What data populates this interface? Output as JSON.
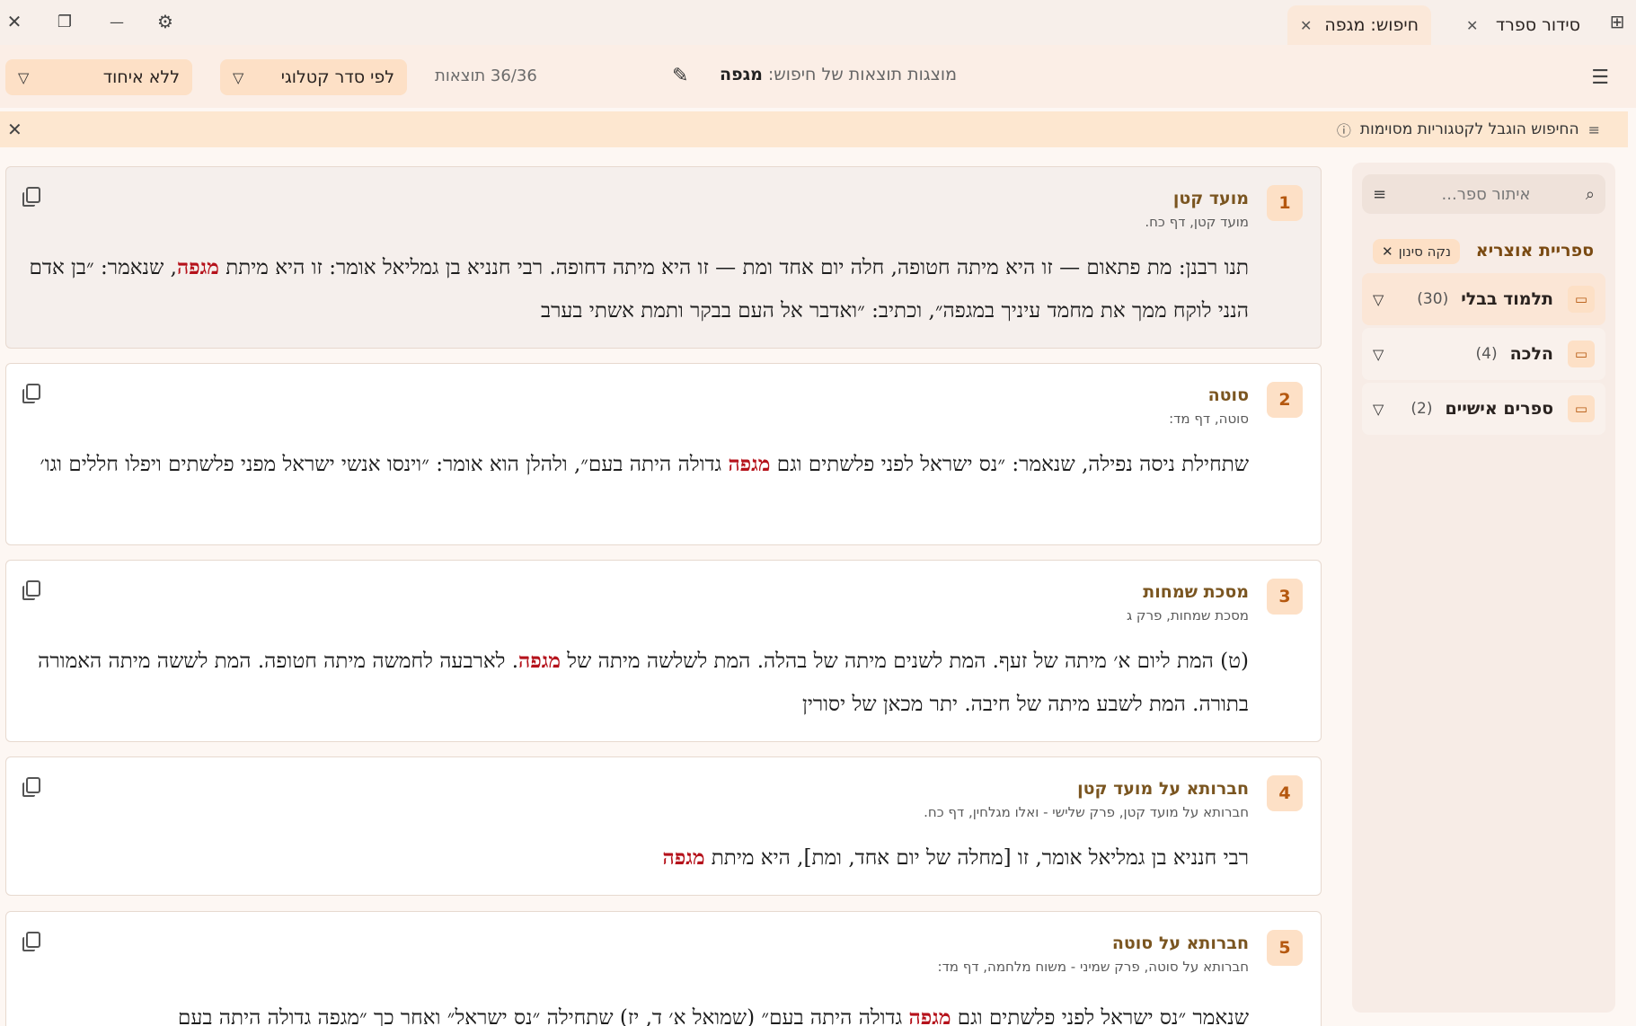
{
  "window": {
    "close_glyph": "✕",
    "restore_glyph": "❐",
    "minimize_glyph": "—",
    "settings_glyph": "⚙",
    "new_tab_glyph": "⊞"
  },
  "tabs": [
    {
      "label": "חיפוש: מגפה",
      "active": true
    },
    {
      "label": "סידור ספרד",
      "active": false
    }
  ],
  "toolbar": {
    "grouping_label": "ללא איחוד",
    "sort_label": "לפי סדר קטלוגי",
    "results_count": "36/36 תוצאות",
    "search_label": "מוצגות תוצאות של חיפוש:",
    "search_query": "מגפה"
  },
  "infobar": {
    "text": "החיפוש הוגבל לקטגוריות מסוימות"
  },
  "results": [
    {
      "num": "1",
      "title": "מועד קטן",
      "ref": "מועד קטן, דף כח.",
      "before": "תנו רבנן: מת פתאום — זו היא מיתה חטופה, חלה יום אחד ומת — זו היא מיתה דחופה. רבי חנניא בן גמליאל אומר: זו היא מיתת ",
      "highlight": "מגפה",
      "after": ", שנאמר: ״בן אדם הנני לוקח ממך את מחמד עיניך במגפה״, וכתיב: ״ואדבר אל העם בבקר ותמת אשתי בערב"
    },
    {
      "num": "2",
      "title": "סוטה",
      "ref": "סוטה, דף מד:",
      "before": "שתחילת ניסה נפילה, שנאמר: ״נס ישראל לפני פלשתים וגם ",
      "highlight": "מגפה",
      "after": " גדולה היתה בעם״, ולהלן הוא אומר: ״וינסו אנשי ישראל מפני פלשתים ויפלו חללים וגו׳"
    },
    {
      "num": "3",
      "title": "מסכת שמחות",
      "ref": "מסכת שמחות, פרק ג",
      "before": "(ט) המת ליום א׳ מיתה של זעף. המת לשנים מיתה של בהלה. המת לשלשה מיתה של ",
      "highlight": "מגפה",
      "after": ". לארבעה לחמשה מיתה חטופה. המת לששה מיתה האמורה בתורה. המת לשבע מיתה של חיבה. יתר מכאן של יסורין"
    },
    {
      "num": "4",
      "title": "חברותא על מועד קטן",
      "ref": "חברותא על מועד קטן, פרק שלישי - ואלו מגלחין, דף כח.",
      "before": "רבי חנניא בן גמליאל אומר, זו [מחלה של יום אחד, ומת], היא מיתת ",
      "highlight": "מגפה",
      "after": ""
    },
    {
      "num": "5",
      "title": "חברותא על סוטה",
      "ref": "חברותא על סוטה, פרק שמיני - משוח מלחמה, דף מד:",
      "before": "שנאמר ״נס ישראל לפני פלשתים וגם ",
      "highlight": "מגפה",
      "after": " גדולה היתה בעם״ (שמואל א׳ ד, יז) שתחילה ״נס ישראל״ ואחר כך ״מגפה גדולה היתה בעם"
    }
  ],
  "sidebar": {
    "search_placeholder": "איתור ספר...",
    "title": "ספריית אוצריא",
    "clear_filter": "נקה סינון",
    "categories": [
      {
        "name": "תלמוד בבלי",
        "count": "(30)"
      },
      {
        "name": "הלכה",
        "count": "(4)"
      },
      {
        "name": "ספרים אישיים",
        "count": "(2)"
      }
    ]
  }
}
